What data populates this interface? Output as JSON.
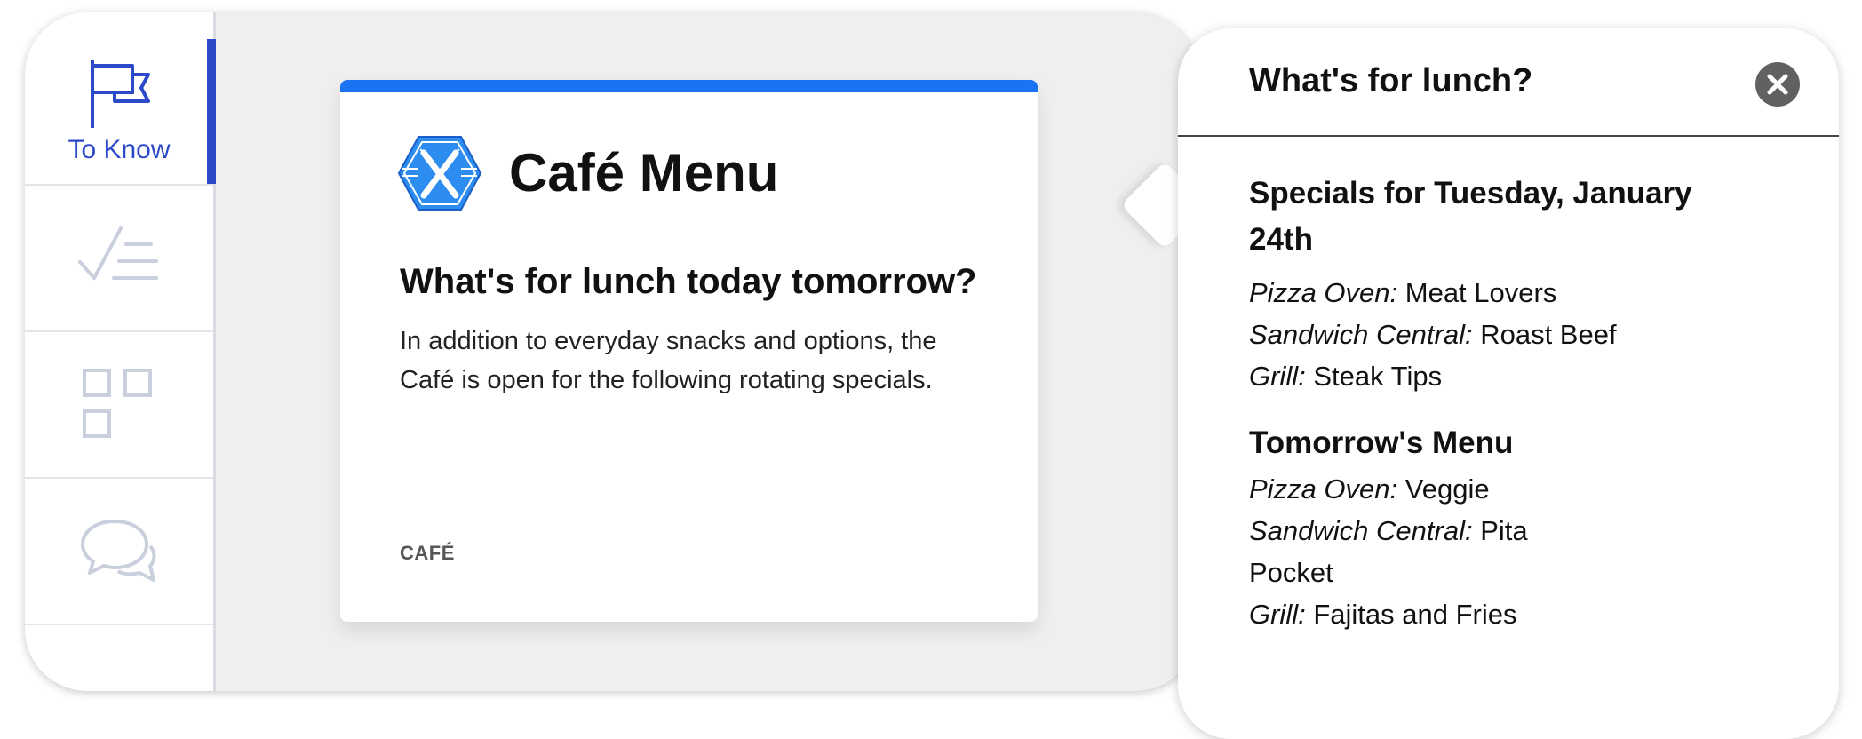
{
  "sidebar": {
    "items": [
      {
        "label": "To Know",
        "icon": "flag-icon",
        "active": true
      },
      {
        "label": "",
        "icon": "checklist-icon",
        "active": false
      },
      {
        "label": "",
        "icon": "grid-icon",
        "active": false
      },
      {
        "label": "",
        "icon": "chat-bubbles-icon",
        "active": false
      }
    ]
  },
  "card": {
    "title": "Café Menu",
    "logo_icon": "fork-knife-hexagon-icon",
    "heading": "What's for lunch today tomorrow?",
    "body": "In addition to everyday snacks and options, the Café is open for the following rotating specials.",
    "tag": "CAFÉ"
  },
  "popover": {
    "title": "What's for lunch?",
    "close_icon": "close-icon",
    "sections": [
      {
        "title": "Specials for Tuesday, January 24th",
        "items": [
          {
            "station": "Pizza Oven:",
            "dish": "Meat Lovers"
          },
          {
            "station": "Sandwich Central:",
            "dish": "Roast Beef"
          },
          {
            "station": "Grill:",
            "dish": "Steak Tips"
          }
        ]
      },
      {
        "title": "Tomorrow's Menu",
        "items": [
          {
            "station": "Pizza Oven:",
            "dish": "Veggie"
          },
          {
            "station": "Sandwich Central:",
            "dish": "Pita Pocket"
          },
          {
            "station": "Grill:",
            "dish": "Fajitas and Fries"
          }
        ]
      }
    ]
  },
  "colors": {
    "accent": "#1a73f2",
    "nav_active": "#2c49c9",
    "nav_inactive_icon": "#c9cfdc",
    "close_bg": "#616161"
  }
}
